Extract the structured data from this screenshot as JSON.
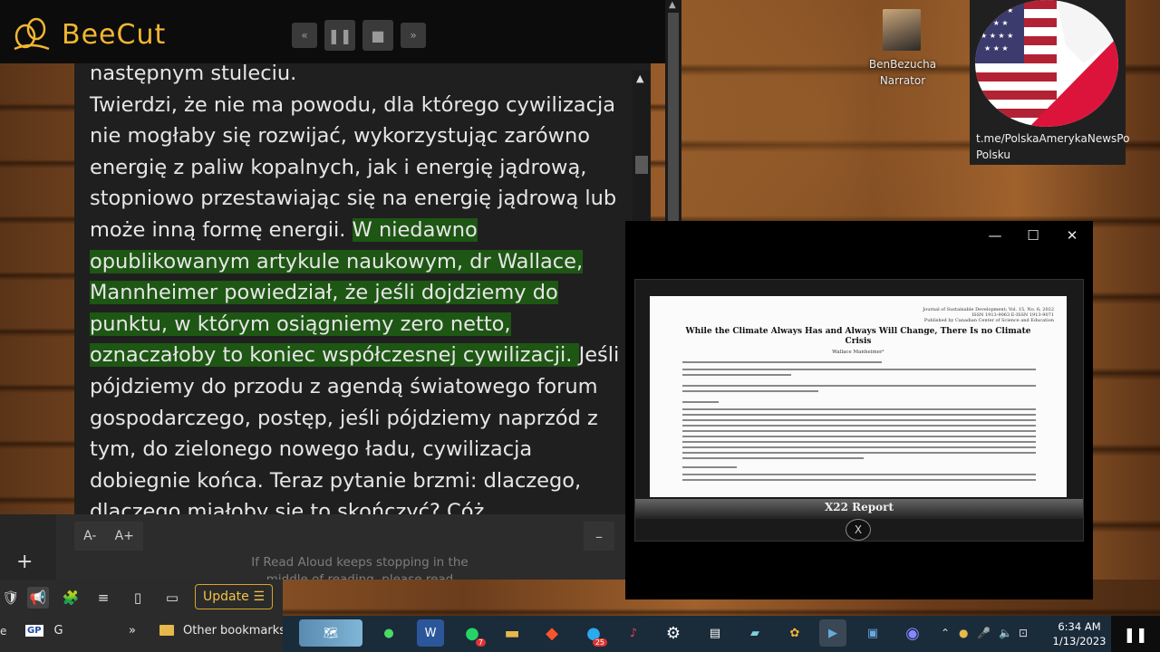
{
  "app": {
    "name": "BeeCut"
  },
  "reader": {
    "cut_top_line": "następnym stuleciu.",
    "para_before_highlight": "Twierdzi, że nie ma powodu, dla którego cywilizacja nie mogłaby się rozwijać, wykorzystując zarówno energię z paliw kopalnych, jak i energię jądrową, stopniowo przestawiając się na energię jądrową lub może inną formę energii.",
    "highlighted": "W niedawno opublikowanym artykule naukowym, dr Wallace, Mannheimer powiedział, że jeśli dojdziemy do punktu, w którym osiągniemy zero netto, oznaczałoby to koniec współczesnej cywilizacji.",
    "para_after_highlight": "Jeśli pójdziemy do przodu z agendą światowego forum gospodarczego, postęp, jeśli pójdziemy naprzód z tym, do zielonego nowego ładu, cywilizacja dobiegnie końca. Teraz pytanie brzmi: dlaczego, dlaczego miałoby się to skończyć? Cóż,",
    "font_decrease": "A-",
    "font_increase": "A+",
    "minus_label": "–",
    "hint": "If Read Aloud keeps stopping in the middle of reading, please read"
  },
  "narrator": {
    "name": "BenBezucha",
    "role": "Narrator"
  },
  "channel": {
    "line1": "t.me/PolskaAmerykaNewsPo",
    "line2": "Polsku"
  },
  "video": {
    "paper_head_1": "Journal of Sustainable Development; Vol. 15, No. 6; 2022",
    "paper_head_2": "ISSN 1913-9063    E-ISSN 1913-9071",
    "paper_head_3": "Published by Canadian Center of Science and Education",
    "paper_title": "While the Climate Always Has and Always Will Change, There Is no Climate Crisis",
    "paper_author": "Wallace Manheimer¹",
    "banner": "X22 Report",
    "logo_glyph": "X"
  },
  "toolbar": {
    "update_label": "Update",
    "update_icon": "☰"
  },
  "bookmarks": {
    "overflow": "»",
    "other": "Other bookmarks",
    "gp_label": "GP",
    "g_label": "G",
    "left_char": "e"
  },
  "clock": {
    "time": "6:34 AM",
    "date": "1/13/2023"
  },
  "taskbar_badges": {
    "whatsapp": "7",
    "telegram": "25"
  },
  "colors": {
    "accent": "#f2b632",
    "highlight": "#1e5614",
    "update": "#f2c346"
  }
}
